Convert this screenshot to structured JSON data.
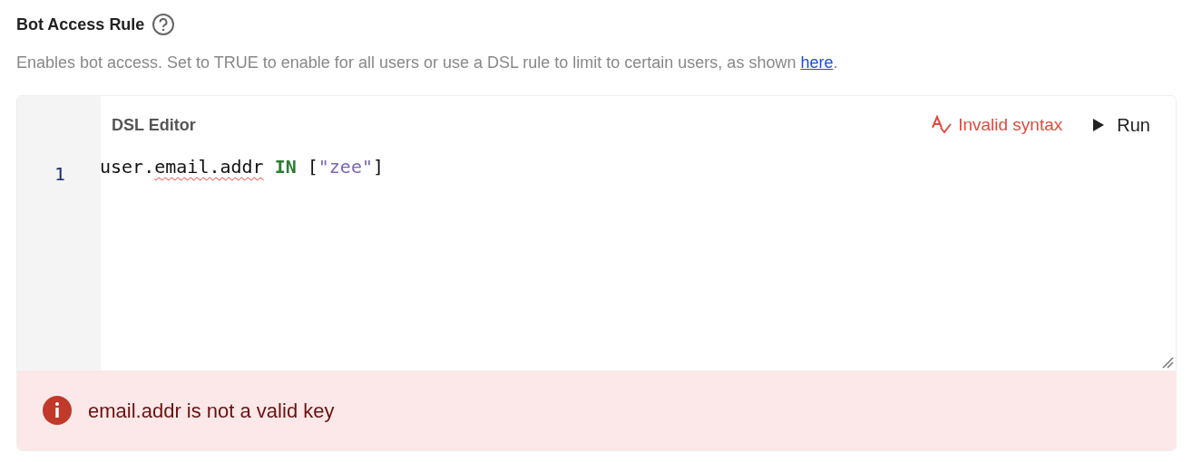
{
  "field": {
    "title": "Bot Access Rule",
    "description": {
      "text": "Enables bot access. Set to TRUE to enable for all users or use a DSL rule to limit to certain users, as shown ",
      "link": "here",
      "after": "."
    }
  },
  "editor": {
    "title": "DSL Editor",
    "status": "Invalid syntax",
    "run_label": "Run",
    "lines": [
      {
        "number": "1",
        "tokens": [
          {
            "text": "user.",
            "kind": "ident",
            "error": false,
            "gap_before": false
          },
          {
            "text": "email.addr",
            "kind": "ident",
            "error": true,
            "gap_before": false
          },
          {
            "text": "IN",
            "kind": "keyword",
            "error": false,
            "gap_before": true
          },
          {
            "text": "[",
            "kind": "punct",
            "error": false,
            "gap_before": true
          },
          {
            "text": "\"zee\"",
            "kind": "string",
            "error": false,
            "gap_before": false
          },
          {
            "text": "]",
            "kind": "punct",
            "error": false,
            "gap_before": false
          }
        ]
      }
    ]
  },
  "error_message": "email.addr is not a valid key"
}
